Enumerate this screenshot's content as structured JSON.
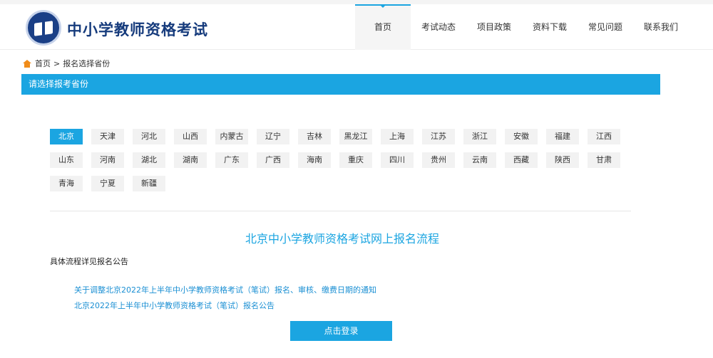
{
  "site": {
    "title": "中小学教师资格考试"
  },
  "nav": [
    {
      "label": "首页",
      "active": true
    },
    {
      "label": "考试动态",
      "active": false
    },
    {
      "label": "项目政策",
      "active": false
    },
    {
      "label": "资料下载",
      "active": false
    },
    {
      "label": "常见问题",
      "active": false
    },
    {
      "label": "联系我们",
      "active": false
    }
  ],
  "breadcrumb": {
    "home": "首页",
    "separator": ">",
    "current": "报名选择省份"
  },
  "section": {
    "title": "请选择报考省份"
  },
  "provinces": {
    "selected": "北京",
    "rows": [
      [
        "北京",
        "天津",
        "河北",
        "山西",
        "内蒙古",
        "辽宁",
        "吉林",
        "黑龙江",
        "上海",
        "江苏",
        "浙江",
        "安徽",
        "福建",
        "江西"
      ],
      [
        "山东",
        "河南",
        "湖北",
        "湖南",
        "广东",
        "广西",
        "海南",
        "重庆",
        "四川",
        "贵州",
        "云南",
        "西藏",
        "陕西",
        "甘肃"
      ],
      [
        "青海",
        "宁夏",
        "新疆"
      ]
    ]
  },
  "flow": {
    "title": "北京中小学教师资格考试网上报名流程",
    "detail": "具体流程详见报名公告",
    "notices": [
      "关于调整北京2022年上半年中小学教师资格考试（笔试）报名、审核、缴费日期的通知",
      "北京2022年上半年中小学教师资格考试（笔试）报名公告"
    ],
    "login_label": "点击登录"
  },
  "colors": {
    "accent": "#1ba5e1",
    "brand": "#163b7c",
    "home_icon": "#f08c1a"
  }
}
